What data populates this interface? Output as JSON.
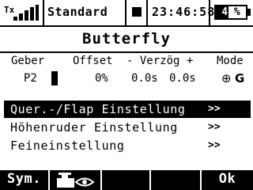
{
  "status_bar": {
    "tx_label": "Tx",
    "signal_icon": "signal-strength-icon",
    "model_name": "Standard",
    "clock": "23:46:58",
    "battery": {
      "percent_text": "41",
      "unit": "%",
      "level": 0.41
    }
  },
  "page": {
    "title": "Butterfly"
  },
  "table": {
    "headers": {
      "geber": "Geber",
      "offset": "Offset",
      "verzoeg": "- Verzög +",
      "mode": "Mode"
    },
    "row": {
      "geber": "P2",
      "offset": "0%",
      "verzoeg_minus": "0.0s",
      "verzoeg_plus": "0.0s",
      "mode_icon": "globe-icon",
      "mode_letter": "G"
    }
  },
  "menu": {
    "items": [
      {
        "label": "Quer.-/Flap Einstellung",
        "arrow": ">>",
        "selected": true
      },
      {
        "label": "Höhenruder Einstellung",
        "arrow": ">>",
        "selected": false
      },
      {
        "label": "Feineinstellung",
        "arrow": ">>",
        "selected": false
      }
    ]
  },
  "softkeys": {
    "sym_label": "Sym.",
    "view_icon": "servo-view-icon",
    "ok_label": "Ok"
  },
  "colors": {
    "background": "#ffffff",
    "foreground": "#000000"
  }
}
